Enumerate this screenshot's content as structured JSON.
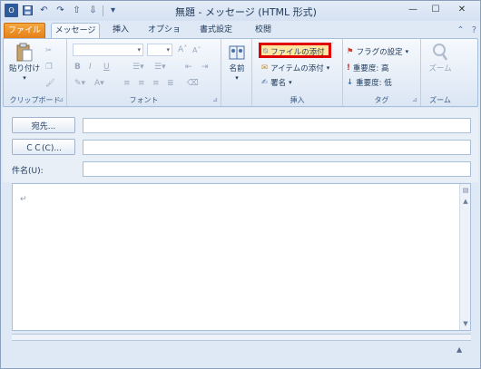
{
  "window": {
    "title": "無題 - メッセージ (HTML 形式)"
  },
  "tabs": {
    "file": "ファイル",
    "message": "メッセージ",
    "insert": "挿入",
    "options": "オプション",
    "format": "書式設定",
    "review": "校閲"
  },
  "ribbon": {
    "clipboard": {
      "paste": "貼り付け",
      "label": "クリップボード"
    },
    "font": {
      "label": "フォント",
      "bold": "B",
      "italic": "I",
      "underline": "U",
      "grow": "A",
      "shrink": "A"
    },
    "names": {
      "address_book": "名前"
    },
    "include": {
      "attach_file": "ファイルの添付",
      "attach_item": "アイテムの添付",
      "signature": "署名",
      "label": "挿入"
    },
    "tags": {
      "follow_up": "フラグの設定",
      "high_importance": "重要度: 高",
      "low_importance": "重要度: 低",
      "label": "タグ"
    },
    "zoom": {
      "zoom": "ズーム",
      "label": "ズーム"
    }
  },
  "header": {
    "to_button": "宛先...",
    "cc_button": "ＣＣ(C)...",
    "subject_label": "件名(U):",
    "to_value": "",
    "cc_value": "",
    "subject_value": ""
  },
  "body": {
    "content": "↵"
  },
  "colors": {
    "file_tab": "#e37c16",
    "highlight": "#e00000",
    "follow_up_flag": "#d23a2a",
    "high_importance": "#e02020",
    "low_importance": "#2b6cc4"
  }
}
